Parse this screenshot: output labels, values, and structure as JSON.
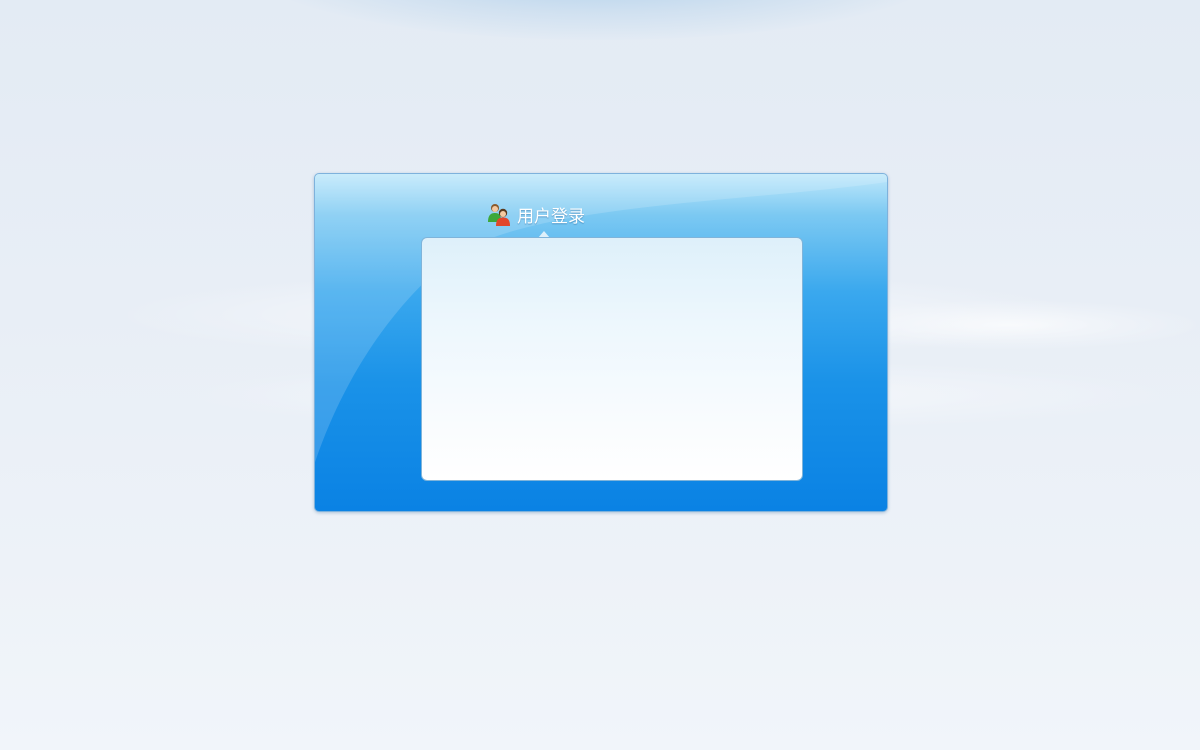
{
  "login": {
    "title": "用户登录",
    "icon": "user-group-icon"
  },
  "colors": {
    "panel_top": "#bfe8fb",
    "panel_bottom": "#0a82e4",
    "box_top": "#def0fa",
    "box_bottom": "#ffffff",
    "background": "#e8eef6"
  }
}
